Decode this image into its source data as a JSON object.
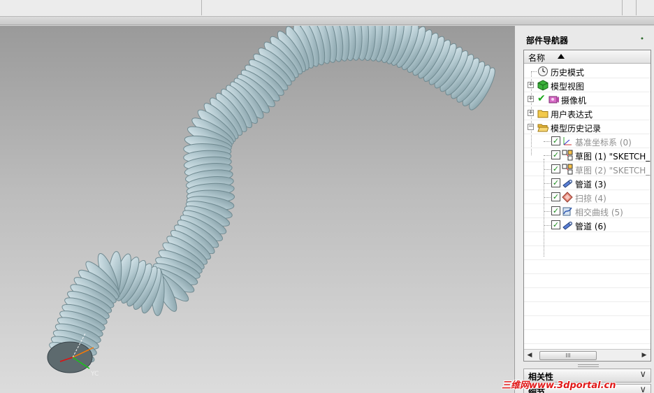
{
  "navigator": {
    "title": "部件导航器",
    "column_header": "名称",
    "rows": [
      {
        "label": "历史模式",
        "dim": false
      },
      {
        "label": "模型视图",
        "dim": false
      },
      {
        "label": "摄像机",
        "dim": false
      },
      {
        "label": "用户表达式",
        "dim": false
      },
      {
        "label": "模型历史记录",
        "dim": false
      },
      {
        "label": "基准坐标系 (0)",
        "dim": true
      },
      {
        "label": "草图 (1) \"SKETCH_0",
        "dim": false
      },
      {
        "label": "草图 (2) \"SKETCH_0",
        "dim": true
      },
      {
        "label": "管道 (3)",
        "dim": false
      },
      {
        "label": "扫掠 (4)",
        "dim": true
      },
      {
        "label": "相交曲线 (5)",
        "dim": true
      },
      {
        "label": "管道 (6)",
        "dim": false
      }
    ],
    "scroll_thumb": "III"
  },
  "sections": {
    "dependencies": "相关性",
    "details": "细节"
  },
  "viewport": {
    "axis_label": "YC",
    "model_color": "#b8cdd4"
  },
  "watermark": "三维网www.3dportal.cn"
}
